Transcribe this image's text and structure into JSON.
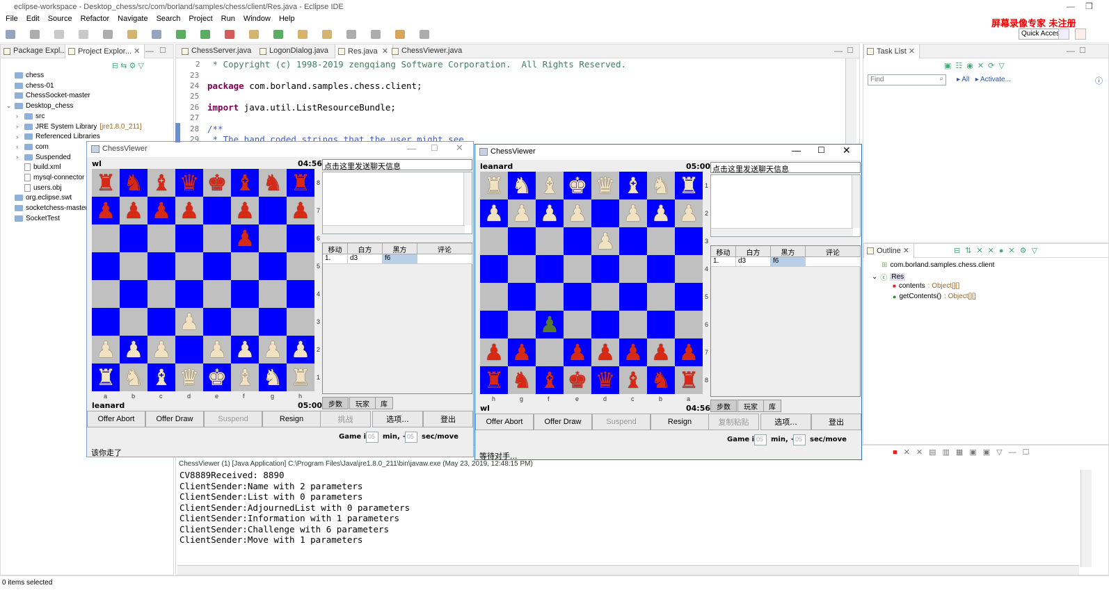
{
  "window": {
    "title": "eclipse-workspace - Desktop_chess/src/com/borland/samples/chess/client/Res.java - Eclipse IDE"
  },
  "menu": [
    "File",
    "Edit",
    "Source",
    "Refactor",
    "Navigate",
    "Search",
    "Project",
    "Run",
    "Window",
    "Help"
  ],
  "watermark": "屏幕录像专家 未注册",
  "quick_access": "Quick Access",
  "left_tabs": [
    "Package Expl...",
    "Project Explor..."
  ],
  "tree": [
    {
      "label": "chess",
      "kind": "folder",
      "indent": 0
    },
    {
      "label": "chess-01",
      "kind": "folder",
      "indent": 0
    },
    {
      "label": "ChessSocket-master",
      "kind": "folder",
      "indent": 0
    },
    {
      "label": "Desktop_chess",
      "kind": "folder",
      "indent": 0,
      "expanded": true
    },
    {
      "label": "src",
      "kind": "folder",
      "indent": 1
    },
    {
      "label": "JRE System Library",
      "suffix": "[jre1.8.0_211]",
      "kind": "folder",
      "indent": 1
    },
    {
      "label": "Referenced Libraries",
      "kind": "folder",
      "indent": 1
    },
    {
      "label": "com",
      "kind": "folder",
      "indent": 1
    },
    {
      "label": "Suspended",
      "kind": "folder",
      "indent": 1
    },
    {
      "label": "build.xml",
      "kind": "file",
      "indent": 1
    },
    {
      "label": "mysql-connector",
      "kind": "file",
      "indent": 1
    },
    {
      "label": "users.obj",
      "kind": "file",
      "indent": 1
    },
    {
      "label": "org.eclipse.swt",
      "kind": "folder",
      "indent": 0
    },
    {
      "label": "socketchess-master",
      "kind": "folder",
      "indent": 0
    },
    {
      "label": "SocketTest",
      "kind": "folder",
      "indent": 0
    }
  ],
  "editor_tabs": [
    "ChessServer.java",
    "LogonDialog.java",
    "Res.java",
    "ChessViewer.java"
  ],
  "code_lines": [
    {
      "num": "2",
      "text": " * Copyright (c) 1998-2019 zengqiang Software Corporation.  All Rights Reserved.",
      "kind": "comment"
    },
    {
      "num": "23",
      "text": "",
      "kind": "plain"
    },
    {
      "num": "24",
      "text": "package com.borland.samples.chess.client;",
      "kind": "kw",
      "kw": "package"
    },
    {
      "num": "25",
      "text": "",
      "kind": "plain"
    },
    {
      "num": "26",
      "text": "import java.util.ListResourceBundle;",
      "kind": "kw",
      "kw": "import"
    },
    {
      "num": "27",
      "text": "",
      "kind": "plain"
    },
    {
      "num": "28",
      "text": "/**",
      "kind": "comment"
    },
    {
      "num": "29",
      "text": " * The hand coded strings that the user might see",
      "kind": "comment"
    }
  ],
  "task_list": {
    "title": "Task List",
    "find_placeholder": "Find",
    "all": "All",
    "activate": "Activate..."
  },
  "outline": {
    "title": "Outline",
    "items": [
      {
        "label": "com.borland.samples.chess.client",
        "type": ""
      },
      {
        "label": "Res",
        "type": ""
      },
      {
        "label": "contents",
        "type": " : Object[][]"
      },
      {
        "label": "getContents()",
        "type": " : Object[][]"
      }
    ]
  },
  "console": {
    "header": "ChessViewer (1) [Java Application] C:\\Program Files\\Java\\jre1.8.0_211\\bin\\javaw.exe (May 23, 2019, 12:48:15 PM)",
    "lines": [
      "CV8889Received: 8890",
      "ClientSender:Name with 2 parameters",
      "ClientSender:List with 0 parameters",
      "ClientSender:AdjournedList with 0 parameters",
      "ClientSender:Information with 1 parameters",
      "ClientSender:Challenge with 6 parameters",
      "ClientSender:Move with 1 parameters"
    ]
  },
  "status_bar": "0 items selected",
  "viewer_left": {
    "title": "ChessViewer",
    "top_player": "wl",
    "top_time": "04:56",
    "bottom_player": "leanard",
    "bottom_time": "05:00",
    "files": [
      "a",
      "b",
      "c",
      "d",
      "e",
      "f",
      "g",
      "h"
    ],
    "ranks": [
      "8",
      "7",
      "6",
      "5",
      "4",
      "3",
      "2",
      "1"
    ],
    "board": [
      [
        "r",
        "n",
        "b",
        "q",
        "k",
        "b",
        "n",
        "r"
      ],
      [
        "p",
        "p",
        "p",
        "p",
        "",
        "p",
        "",
        "p"
      ],
      [
        "",
        "",
        "",
        "",
        "",
        "p",
        "",
        ""
      ],
      [
        "",
        "",
        "",
        "",
        "",
        "",
        "",
        ""
      ],
      [
        "",
        "",
        "",
        "",
        "",
        "",
        "",
        ""
      ],
      [
        "",
        "",
        "",
        "P",
        "",
        "",
        "",
        ""
      ],
      [
        "P",
        "P",
        "P",
        "",
        "P",
        "P",
        "P",
        "P"
      ],
      [
        "R",
        "N",
        "B",
        "Q",
        "K",
        "B",
        "N",
        "R"
      ]
    ],
    "chat": "点击这里发送聊天信息",
    "move_headers": [
      "移动",
      "白方",
      "黑方",
      "评论"
    ],
    "move_row": [
      "1.",
      "d3",
      "f6",
      ""
    ],
    "subtabs": [
      "步数",
      "玩家",
      "库"
    ],
    "buttons": [
      "Offer Abort",
      "Offer Draw",
      "Suspend",
      "Resign"
    ],
    "right_buttons": [
      "挑战",
      "选项...",
      "登出"
    ],
    "game_in": "Game in",
    "min": "05",
    "min_label": "min, +",
    "sec": "05",
    "sec_label": "sec/move",
    "status": "该你走了"
  },
  "viewer_right": {
    "title": "ChessViewer",
    "top_player": "leanard",
    "top_time": "05:00",
    "bottom_player": "wl",
    "bottom_time": "04:56",
    "files": [
      "h",
      "g",
      "f",
      "e",
      "d",
      "c",
      "b",
      "a"
    ],
    "ranks": [
      "1",
      "2",
      "3",
      "4",
      "5",
      "6",
      "7",
      "8"
    ],
    "board": [
      [
        "R",
        "N",
        "B",
        "K",
        "Q",
        "B",
        "N",
        "R"
      ],
      [
        "P",
        "P",
        "P",
        "P",
        "",
        "P",
        "P",
        "P"
      ],
      [
        "",
        "",
        "",
        "",
        "P",
        "",
        "",
        ""
      ],
      [
        "",
        "",
        "",
        "",
        "",
        "",
        "",
        ""
      ],
      [
        "",
        "",
        "",
        "",
        "",
        "",
        "",
        ""
      ],
      [
        "",
        "",
        "g",
        "",
        "",
        "",
        "",
        ""
      ],
      [
        "p",
        "p",
        "",
        "p",
        "p",
        "p",
        "p",
        "p"
      ],
      [
        "r",
        "n",
        "b",
        "k",
        "q",
        "b",
        "n",
        "r"
      ]
    ],
    "chat": "点击这里发送聊天信息",
    "move_headers": [
      "移动",
      "白方",
      "黑方",
      "评论"
    ],
    "move_row": [
      "1.",
      "d3",
      "f6",
      ""
    ],
    "subtabs": [
      "步数",
      "玩家",
      "库"
    ],
    "buttons": [
      "Offer Abort",
      "Offer Draw",
      "Suspend",
      "Resign"
    ],
    "right_buttons": [
      "复制粘贴",
      "选项...",
      "登出"
    ],
    "game_in": "Game in",
    "min": "05",
    "min_label": "min, +",
    "sec": "05",
    "sec_label": "sec/move",
    "status": "等待对手..."
  }
}
